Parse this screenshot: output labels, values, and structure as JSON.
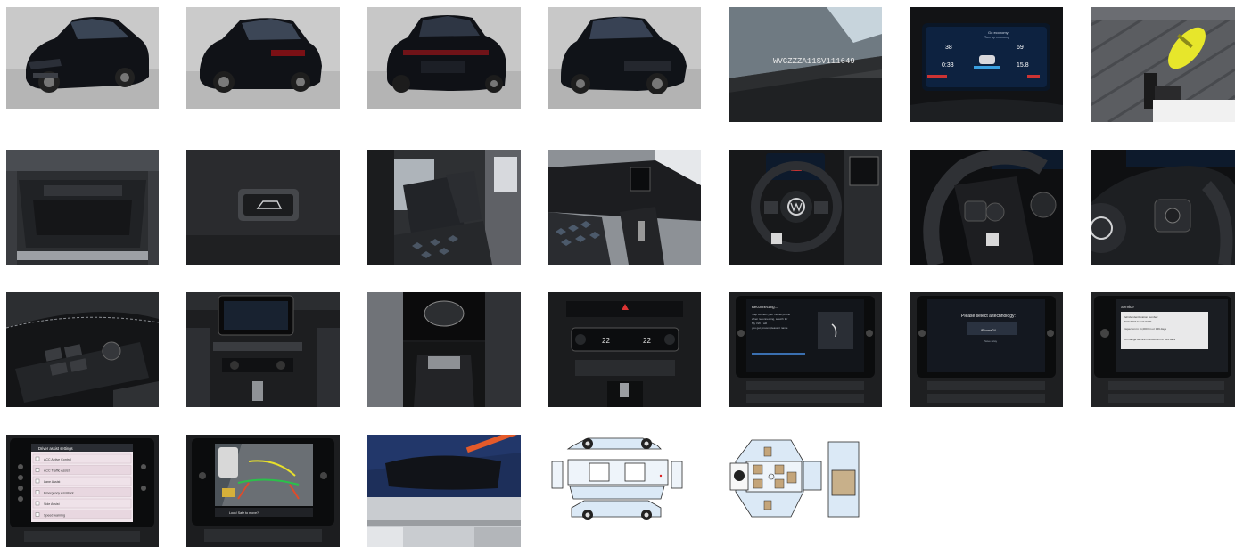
{
  "gallery": {
    "vin_plate": "WVGZZZA11SV111649",
    "cluster": {
      "top_line_1": "Go economy",
      "top_line_2": "Turn up economy",
      "range_value": "38",
      "range_unit": "km",
      "cons_value": "69",
      "trip_value": "0:33",
      "trip_unit": "h",
      "dist_value": "15.8",
      "dist_unit": "km"
    },
    "screens": {
      "reconnect_title": "Reconnecting...",
      "reconnect_line_1": "Step connect your mobile phone",
      "reconnect_line_2": "when reconnecting, search for",
      "reconnect_line_3": "My VW. I will",
      "reconnect_line_4": "you get proven pleasant name",
      "tech_prompt": "Please select a technology:",
      "tech_option": "iPhone24",
      "tech_option_2": "Save relay",
      "service_title": "Service",
      "service_line_1": "Vehicle identification number:",
      "service_line_2": "WVGZZZA11SV111649",
      "service_line_3": "Inspection in 11,000 km or 349 days",
      "service_line_4": "Oil change service in 11000 km or 349 days",
      "assist_title": "Driver assist settings",
      "assist_items": [
        "ACC Active Control",
        "ACC Traffic Assist",
        "Lane Assist",
        "Emergency Assistant",
        "Side Assist",
        "Speed warning"
      ],
      "camera_caption": "Look! Safe to move?"
    }
  }
}
